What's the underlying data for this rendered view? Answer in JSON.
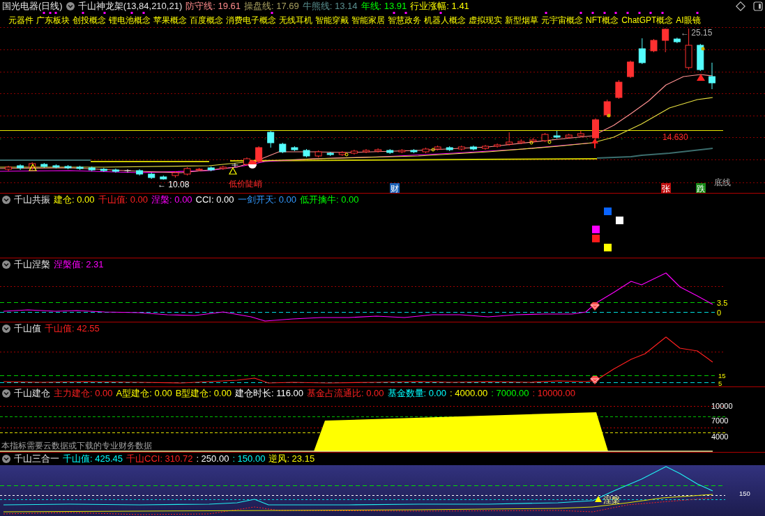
{
  "header": {
    "stock": "国光电器(日线)",
    "indicator": "千山神龙架(13,84,210,21)",
    "values": [
      {
        "text": "防守线: 19.61",
        "color": "#ff8c8c"
      },
      {
        "text": "操盘线: 17.69",
        "color": "#a8a060"
      },
      {
        "text": "牛熊线: 13.14",
        "color": "#5a9090"
      },
      {
        "text": "年线: 13.91",
        "color": "#00ff00"
      },
      {
        "text": "行业涨幅: 1.41",
        "color": "#ffff00"
      }
    ]
  },
  "concepts": [
    "元器件",
    "广东板块",
    "创投概念",
    "锂电池概念",
    "苹果概念",
    "百度概念",
    "消费电子概念",
    "无线耳机",
    "智能穿戴",
    "智能家居",
    "智慧政务",
    "机器人概念",
    "虚拟现实",
    "新型烟草",
    "元宇宙概念",
    "NFT概念",
    "ChatGPT概念",
    "AI眼镜"
  ],
  "main_chart": {
    "high_price": "← 25.15",
    "level_price": "14.630",
    "low_price": "← 10.08",
    "signal_text": "低价陡峭",
    "baseline_label": "底线",
    "event_tags": [
      {
        "text": "财",
        "color": "#1a5fb4"
      },
      {
        "text": "张",
        "color": "#c01010"
      },
      {
        "text": "跌",
        "color": "#178a17"
      }
    ]
  },
  "panels": [
    {
      "kind": "resonance",
      "title": "千山共振",
      "values": [
        {
          "text": "建仓: 0.00",
          "color": "#ffff00"
        },
        {
          "text": "千山值: 0.00",
          "color": "#ff2020"
        },
        {
          "text": "涅槃: 0.00",
          "color": "#ff00ff"
        },
        {
          "text": "CCI: 0.00",
          "color": "#ffffff"
        },
        {
          "text": "一剑开天: 0.00",
          "color": "#3399ff"
        },
        {
          "text": "低开擒牛: 0.00",
          "color": "#00ff00"
        }
      ]
    },
    {
      "kind": "nirvana",
      "title": "千山涅槃",
      "values": [
        {
          "text": "涅槃值: 2.31",
          "color": "#ff00ff"
        }
      ],
      "levels": [
        "3.5",
        "0"
      ]
    },
    {
      "kind": "qianshan",
      "title": "千山值",
      "values": [
        {
          "text": "千山值: 42.55",
          "color": "#ff2020"
        }
      ],
      "levels": [
        "15",
        "5"
      ]
    },
    {
      "kind": "build",
      "title": "千山建仓",
      "values": [
        {
          "text": "主力建仓: 0.00",
          "color": "#ff2020"
        },
        {
          "text": "A型建仓: 0.00",
          "color": "#ffff00"
        },
        {
          "text": "B型建仓: 0.00",
          "color": "#ffff00"
        },
        {
          "text": "建仓时长: 116.00",
          "color": "#ffffff"
        },
        {
          "text": "基金占流通比: 0.00",
          "color": "#ff2020"
        },
        {
          "text": "基金数量: 0.00",
          "color": "#00ffff"
        },
        {
          "text": ": 4000.00",
          "color": "#ffff00"
        },
        {
          "text": ": 7000.00",
          "color": "#00ff00"
        },
        {
          "text": ": 10000.00",
          "color": "#ff2020"
        }
      ],
      "levels": [
        "10000",
        "7000",
        "4000"
      ],
      "note": "本指标需要云数据或下载的专业财务数据"
    },
    {
      "kind": "triple",
      "title": "千山三合一",
      "values": [
        {
          "text": "千山值: 425.45",
          "color": "#00ffff"
        },
        {
          "text": "千山CCI: 310.72",
          "color": "#ff2020"
        },
        {
          "text": ": 250.00",
          "color": "#ffffff"
        },
        {
          "text": ": 150.00",
          "color": "#00ffff"
        },
        {
          "text": "逆风: 23.15",
          "color": "#ffff00"
        }
      ],
      "levels": [
        "150"
      ],
      "signal_text": "涅槃"
    }
  ]
}
